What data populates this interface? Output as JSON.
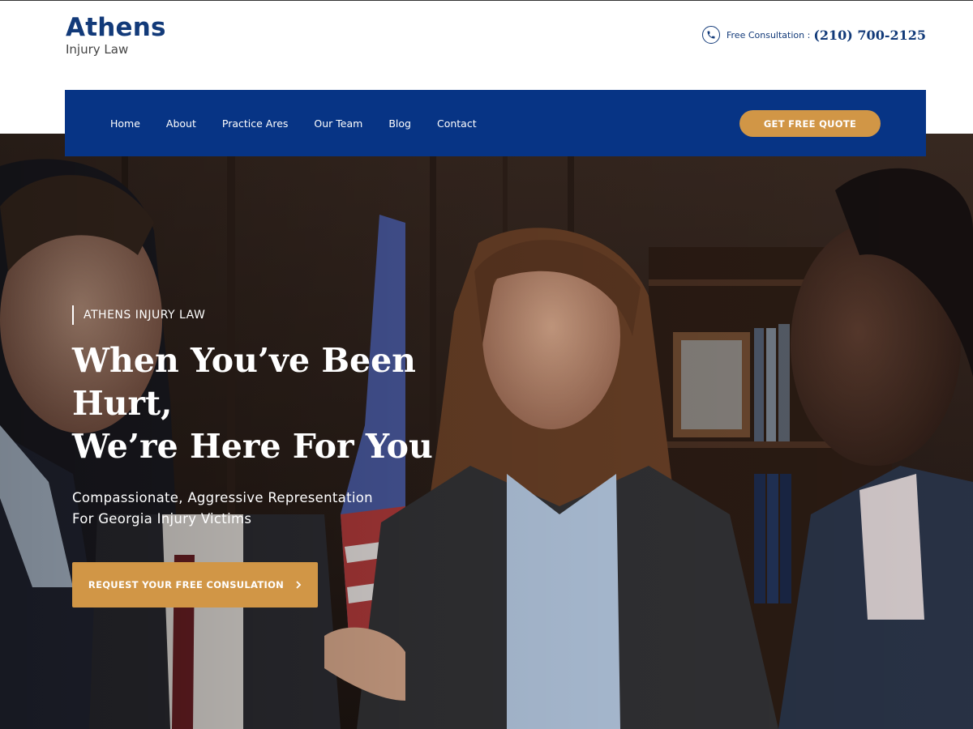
{
  "brand": {
    "title": "Athens",
    "subtitle": "Injury Law"
  },
  "contact": {
    "label": "Free Consultation :",
    "phone": "(210) 700-2125",
    "icon": "phone-icon"
  },
  "nav": {
    "items": [
      {
        "label": "Home"
      },
      {
        "label": "About"
      },
      {
        "label": "Practice Ares"
      },
      {
        "label": "Our Team"
      },
      {
        "label": "Blog"
      },
      {
        "label": "Contact"
      }
    ],
    "quote_button": "GET FREE QUOTE"
  },
  "hero": {
    "eyebrow": "ATHENS INJURY LAW",
    "headline_line1": "When You’ve Been Hurt,",
    "headline_line2": "We’re Here For You",
    "subhead_line1": "Compassionate, Aggressive Representation",
    "subhead_line2": "For Georgia Injury Victims",
    "cta_label": "REQUEST YOUR FREE CONSULATION",
    "cta_icon": "chevron-right-icon"
  },
  "colors": {
    "brand_navy": "#073485",
    "logo_navy": "#123a79",
    "accent_gold": "#d19646"
  }
}
